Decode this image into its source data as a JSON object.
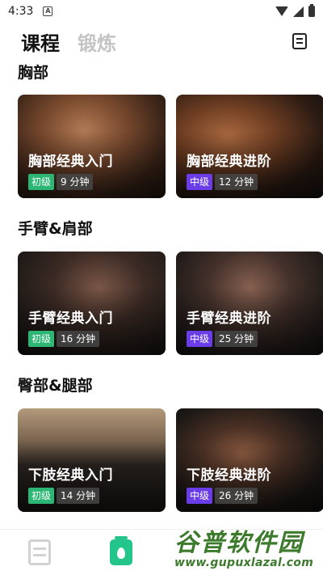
{
  "status_bar": {
    "time": "4:33",
    "app_icon_letter": "A"
  },
  "header": {
    "tabs": [
      {
        "label": "课程",
        "active": true
      },
      {
        "label": "锻炼",
        "active": false
      }
    ]
  },
  "sections": [
    {
      "title": "胸部",
      "cards": [
        {
          "title": "胸部经典入门",
          "level": "初级",
          "duration": "9 分钟"
        },
        {
          "title": "胸部经典进阶",
          "level": "中级",
          "duration": "12 分钟"
        }
      ]
    },
    {
      "title": "手臂&肩部",
      "cards": [
        {
          "title": "手臂经典入门",
          "level": "初级",
          "duration": "16 分钟"
        },
        {
          "title": "手臂经典进阶",
          "level": "中级",
          "duration": "25 分钟"
        }
      ]
    },
    {
      "title": "臀部&腿部",
      "cards": [
        {
          "title": "下肢经典入门",
          "level": "初级",
          "duration": "14 分钟"
        },
        {
          "title": "下肢经典进阶",
          "level": "中级",
          "duration": "26 分钟"
        }
      ]
    }
  ],
  "colors": {
    "beginner": "#2bb673",
    "advanced": "#6a3de8",
    "active_nav": "#23c58a"
  },
  "watermark": {
    "brand": "谷普软件园",
    "url": "www.gupuxlazal.com"
  }
}
